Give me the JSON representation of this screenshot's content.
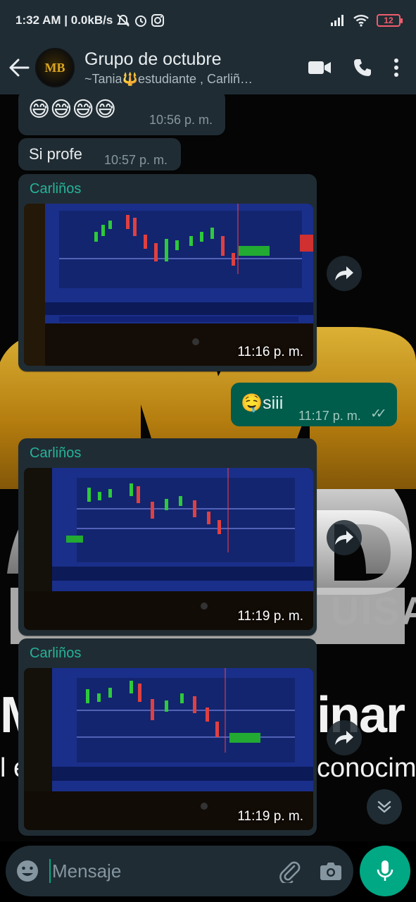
{
  "status_bar": {
    "time_speed": "1:32 AM | 0.0kB/s",
    "battery": "12"
  },
  "header": {
    "group_name": "Grupo de octubre",
    "members": "~Tania🔱estudiante , Carliñ…",
    "avatar_text": "MB"
  },
  "messages": [
    {
      "type": "text",
      "text": "😅😅😅😅",
      "time": "10:56 p. m."
    },
    {
      "type": "text",
      "text": "Si profe",
      "time": "10:57 p. m."
    },
    {
      "type": "image",
      "sender": "Carliños",
      "time": "11:16 p. m."
    },
    {
      "type": "text_out",
      "text": "🤤siii",
      "time": "11:17 p. m.",
      "ticks": "✓✓"
    },
    {
      "type": "image",
      "sender": "Carliños",
      "time": "11:19 p. m."
    },
    {
      "type": "image",
      "sender": "Carliños",
      "time": "11:19 p. m."
    }
  ],
  "wallpaper_text": {
    "line1": "Ma",
    "line1b": "inar",
    "line2": "l é",
    "line2b": "conocimie",
    "brand": "UISA"
  },
  "composer": {
    "placeholder": "Mensaje"
  },
  "colors": {
    "header_bg": "#1f2c34",
    "incoming_bubble": "#202c33",
    "outgoing_bubble": "#005c4b",
    "accent": "#00a884",
    "sender_name": "#25b39a"
  }
}
